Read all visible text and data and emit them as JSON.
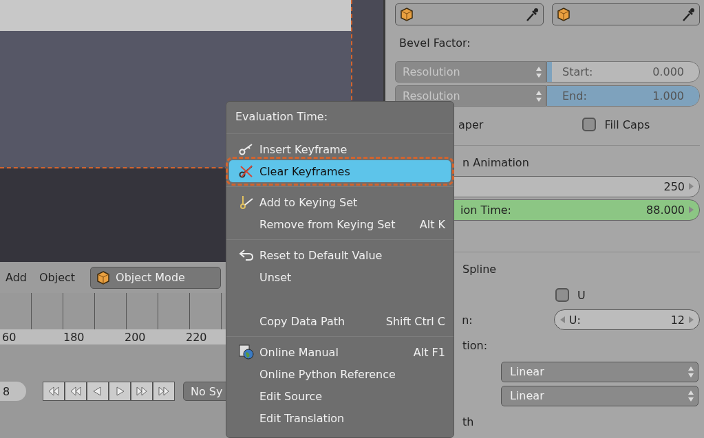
{
  "viewport_header": {
    "menus": [
      "Add",
      "Object"
    ],
    "mode": "Object Mode"
  },
  "timeline": {
    "ticks": [
      "60",
      "180",
      "200",
      "220"
    ]
  },
  "playback": {
    "frame": "8",
    "sync": "No Sy"
  },
  "properties": {
    "bevel_label": "Bevel Factor:",
    "bevel_rows": [
      {
        "mode": "Resolution",
        "label": "Start:",
        "value": "0.000",
        "level": 0
      },
      {
        "mode": "Resolution",
        "label": "End:",
        "value": "1.000",
        "level": 1
      }
    ],
    "taper_fragment": "aper",
    "fill_caps": {
      "label": "Fill Caps",
      "checked": false
    },
    "path_animation_fragment": "n Animation",
    "frames_value": "250",
    "eval_fragment": "ion Time:",
    "eval_value": "88.000",
    "eval_keyframed": true,
    "active_spline_fragment": "Spline",
    "cyclic_u": {
      "label": "U",
      "checked": false
    },
    "resolution_fragment": "n:",
    "resolution_u": {
      "label": "U:",
      "value": "12"
    },
    "interpolation_fragment": "tion:",
    "tilt": "Linear",
    "radius": "Linear",
    "smooth_fragment": "th"
  },
  "context_menu": {
    "title": "Evaluation Time:",
    "groups": [
      [
        {
          "label": "Insert Keyframe",
          "kind": "key",
          "selected": false
        },
        {
          "label": "Clear Keyframes",
          "kind": "clear",
          "selected": true
        }
      ],
      [
        {
          "label": "Add to Keying Set",
          "kind": "keyset",
          "selected": false
        },
        {
          "label": "Remove from Keying Set",
          "shortcut": "Alt K",
          "selected": false
        }
      ],
      [
        {
          "label": "Reset to Default Value",
          "kind": "reset",
          "selected": false
        },
        {
          "label": "Unset",
          "selected": false
        },
        {
          "label": "Copy Data Path",
          "shortcut": "Shift Ctrl C",
          "gap_before": true,
          "selected": false
        }
      ],
      [
        {
          "label": "Online Manual",
          "kind": "globe",
          "shortcut": "Alt F1",
          "selected": false
        },
        {
          "label": "Online Python Reference",
          "selected": false
        },
        {
          "label": "Edit Source",
          "selected": false
        },
        {
          "label": "Edit Translation",
          "selected": false
        }
      ]
    ]
  }
}
